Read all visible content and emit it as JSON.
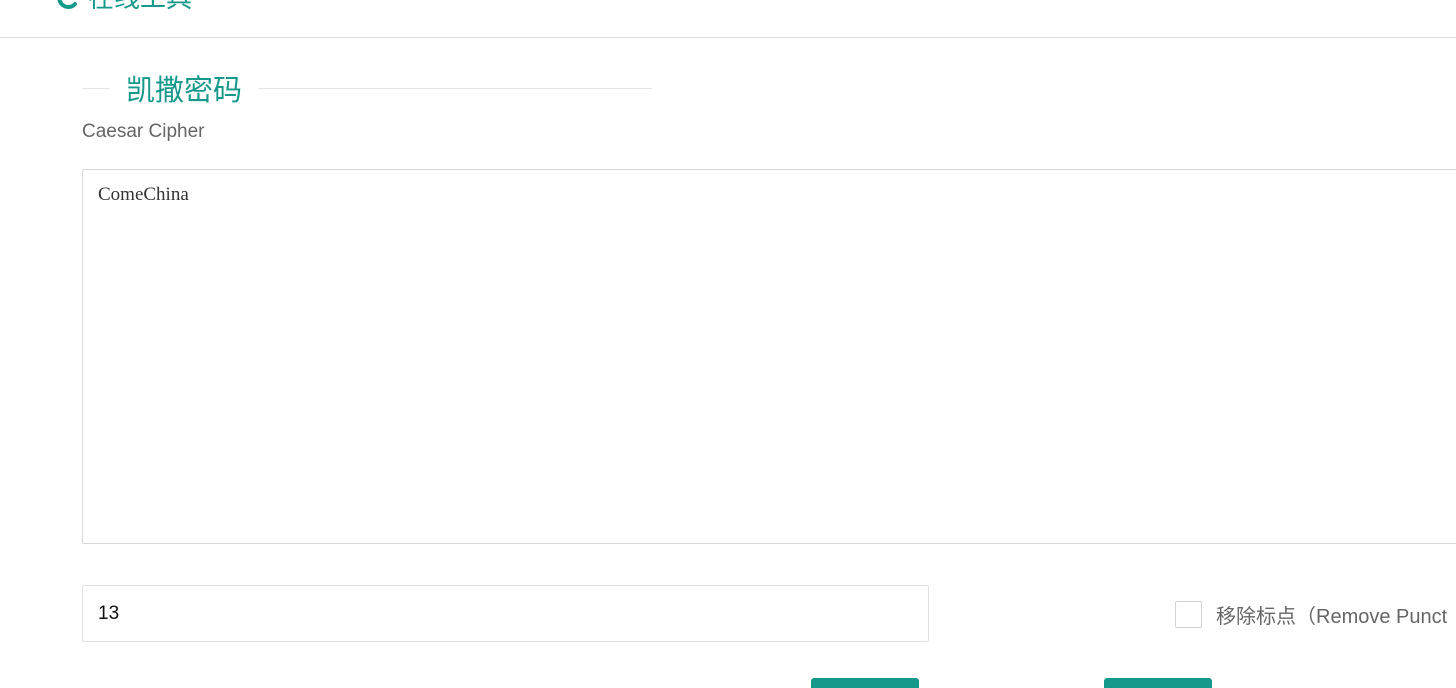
{
  "header": {
    "brand_text": "在线工具",
    "brand_icon": "logo-c-icon",
    "accent_color": "#16998a"
  },
  "section": {
    "title": "凯撒密码",
    "subtitle": "Caesar Cipher"
  },
  "input_text": {
    "value": "ComeChina"
  },
  "shift": {
    "value": "13"
  },
  "remove_punctuation": {
    "label": "移除标点（Remove Punct",
    "checked": false
  }
}
